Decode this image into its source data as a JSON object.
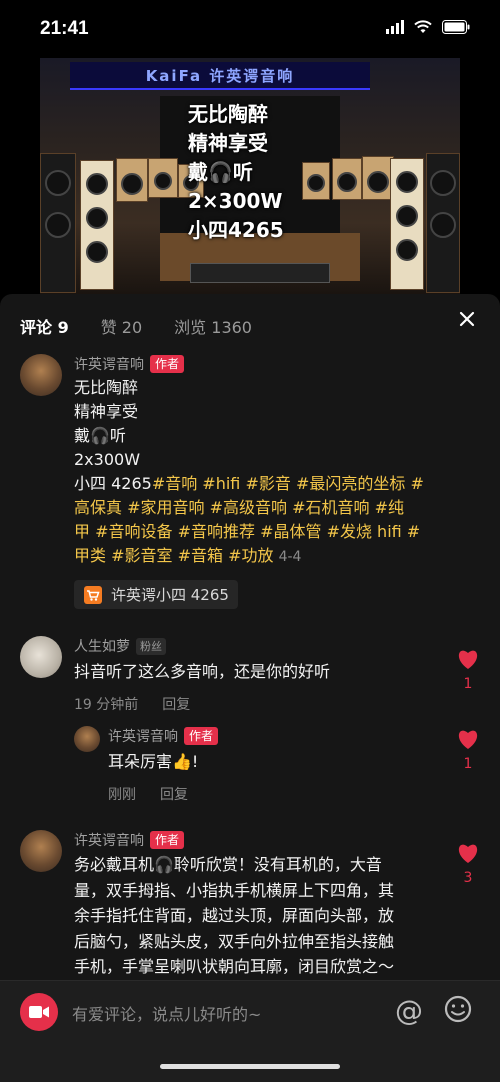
{
  "status_bar": {
    "time": "21:41"
  },
  "video": {
    "brand": "KaiFa 许英谔音响",
    "overlay_lines": [
      "无比陶醉",
      "精神享受",
      "戴🎧听",
      "2×300W",
      "小四4265"
    ]
  },
  "tabs": [
    {
      "label": "评论 9"
    },
    {
      "label": "赞 20"
    },
    {
      "label": "浏览 1360"
    }
  ],
  "comments": [
    {
      "user": "许英谔音响",
      "badge": "作者",
      "lines": [
        "无比陶醉",
        "精神享受",
        "戴🎧听",
        "2x300W"
      ],
      "tag_line_1_prefix": "小四 4265",
      "tags_1": "#音响 #hifi #影音 #最闪亮的坐标 #",
      "tags_2": "高保真 #家用音响 #高级音响 #石机音响 #纯",
      "tags_3": "甲 #音响设备 #音响推荐 #晶体管 #发烧 hifi #",
      "tags_4": "甲类 #影音室 #音箱 #功放",
      "date": "4-4",
      "product": "许英谔小四 4265"
    },
    {
      "user": "人生如萝",
      "badge": "粉丝",
      "text": "抖音听了这么多音响，还是你的好听",
      "time": "19 分钟前",
      "reply": "回复",
      "likes": "1"
    },
    {
      "user": "许英谔音响",
      "badge": "作者",
      "text": "耳朵厉害👍!",
      "time": "刚刚",
      "reply": "回复",
      "likes": "1"
    },
    {
      "user": "许英谔音响",
      "badge": "作者",
      "lines": [
        "务必戴耳机🎧聆听欣赏！没有耳机的，大音",
        "量，双手拇指、小指执手机横屏上下四角，其",
        "余手指托住背面，越过头顶，屏面向头部，放",
        "后脑勺，紧贴头皮，双手向外拉伸至指头接触",
        "手机，手掌呈喇叭状朝向耳廓，闭目欣赏之～"
      ],
      "likes": "3"
    }
  ],
  "input": {
    "placeholder": "有爱评论，说点儿好听的~"
  },
  "colors": {
    "accent": "#e5304a",
    "tag": "#f3c64a",
    "panel": "#161616"
  }
}
